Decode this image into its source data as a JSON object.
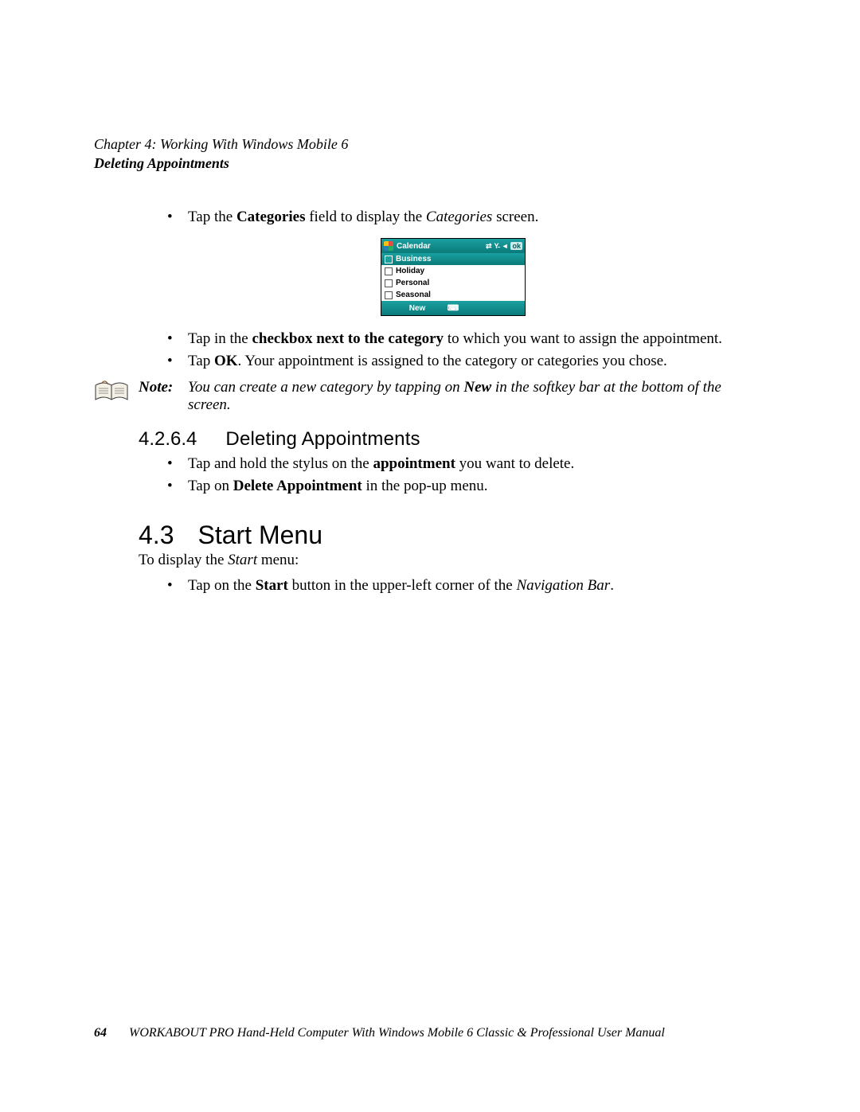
{
  "header": {
    "chapter_line": "Chapter  4:  Working With Windows Mobile 6",
    "subtitle": "Deleting Appointments"
  },
  "bullets_top": [
    {
      "pre": "Tap the ",
      "b1": "Categories",
      "mid": " field to display the ",
      "i1": "Categories",
      "post": " screen."
    }
  ],
  "device": {
    "title": "Calendar",
    "ok_label": "ok",
    "selected_category": "Business",
    "categories": [
      "Holiday",
      "Personal",
      "Seasonal"
    ],
    "softkey_new": "New"
  },
  "bullets_mid": [
    {
      "pre": "Tap in the ",
      "b1": "checkbox next to the category",
      "post": " to which you want to assign the appointment."
    },
    {
      "pre": "Tap ",
      "b1": "OK",
      "post": ". Your appointment is assigned to the category or categories you chose."
    }
  ],
  "note": {
    "label": "Note:",
    "text_pre": "You can create a new category by tapping on ",
    "text_bold": "New",
    "text_post": " in the softkey bar at the bottom of the screen."
  },
  "section_4264": {
    "num": "4.2.6.4",
    "title": "Deleting Appointments"
  },
  "bullets_del": [
    {
      "pre": "Tap and hold the stylus on the ",
      "b1": "appointment",
      "post": " you want to delete."
    },
    {
      "pre": "Tap on ",
      "b1": "Delete Appointment",
      "post": " in the pop-up menu."
    }
  ],
  "section_43": {
    "num": "4.3",
    "title": "Start Menu"
  },
  "start_intro_pre": "To display the ",
  "start_intro_i": "Start",
  "start_intro_post": " menu:",
  "bullets_start": [
    {
      "pre": "Tap on the ",
      "b1": "Start",
      "mid": " button in the upper-left corner of the ",
      "i1": "Navigation Bar",
      "post": "."
    }
  ],
  "footer": {
    "page_number": "64",
    "title": "WORKABOUT PRO Hand-Held Computer With Windows Mobile 6 Classic & Professional User Manual"
  }
}
